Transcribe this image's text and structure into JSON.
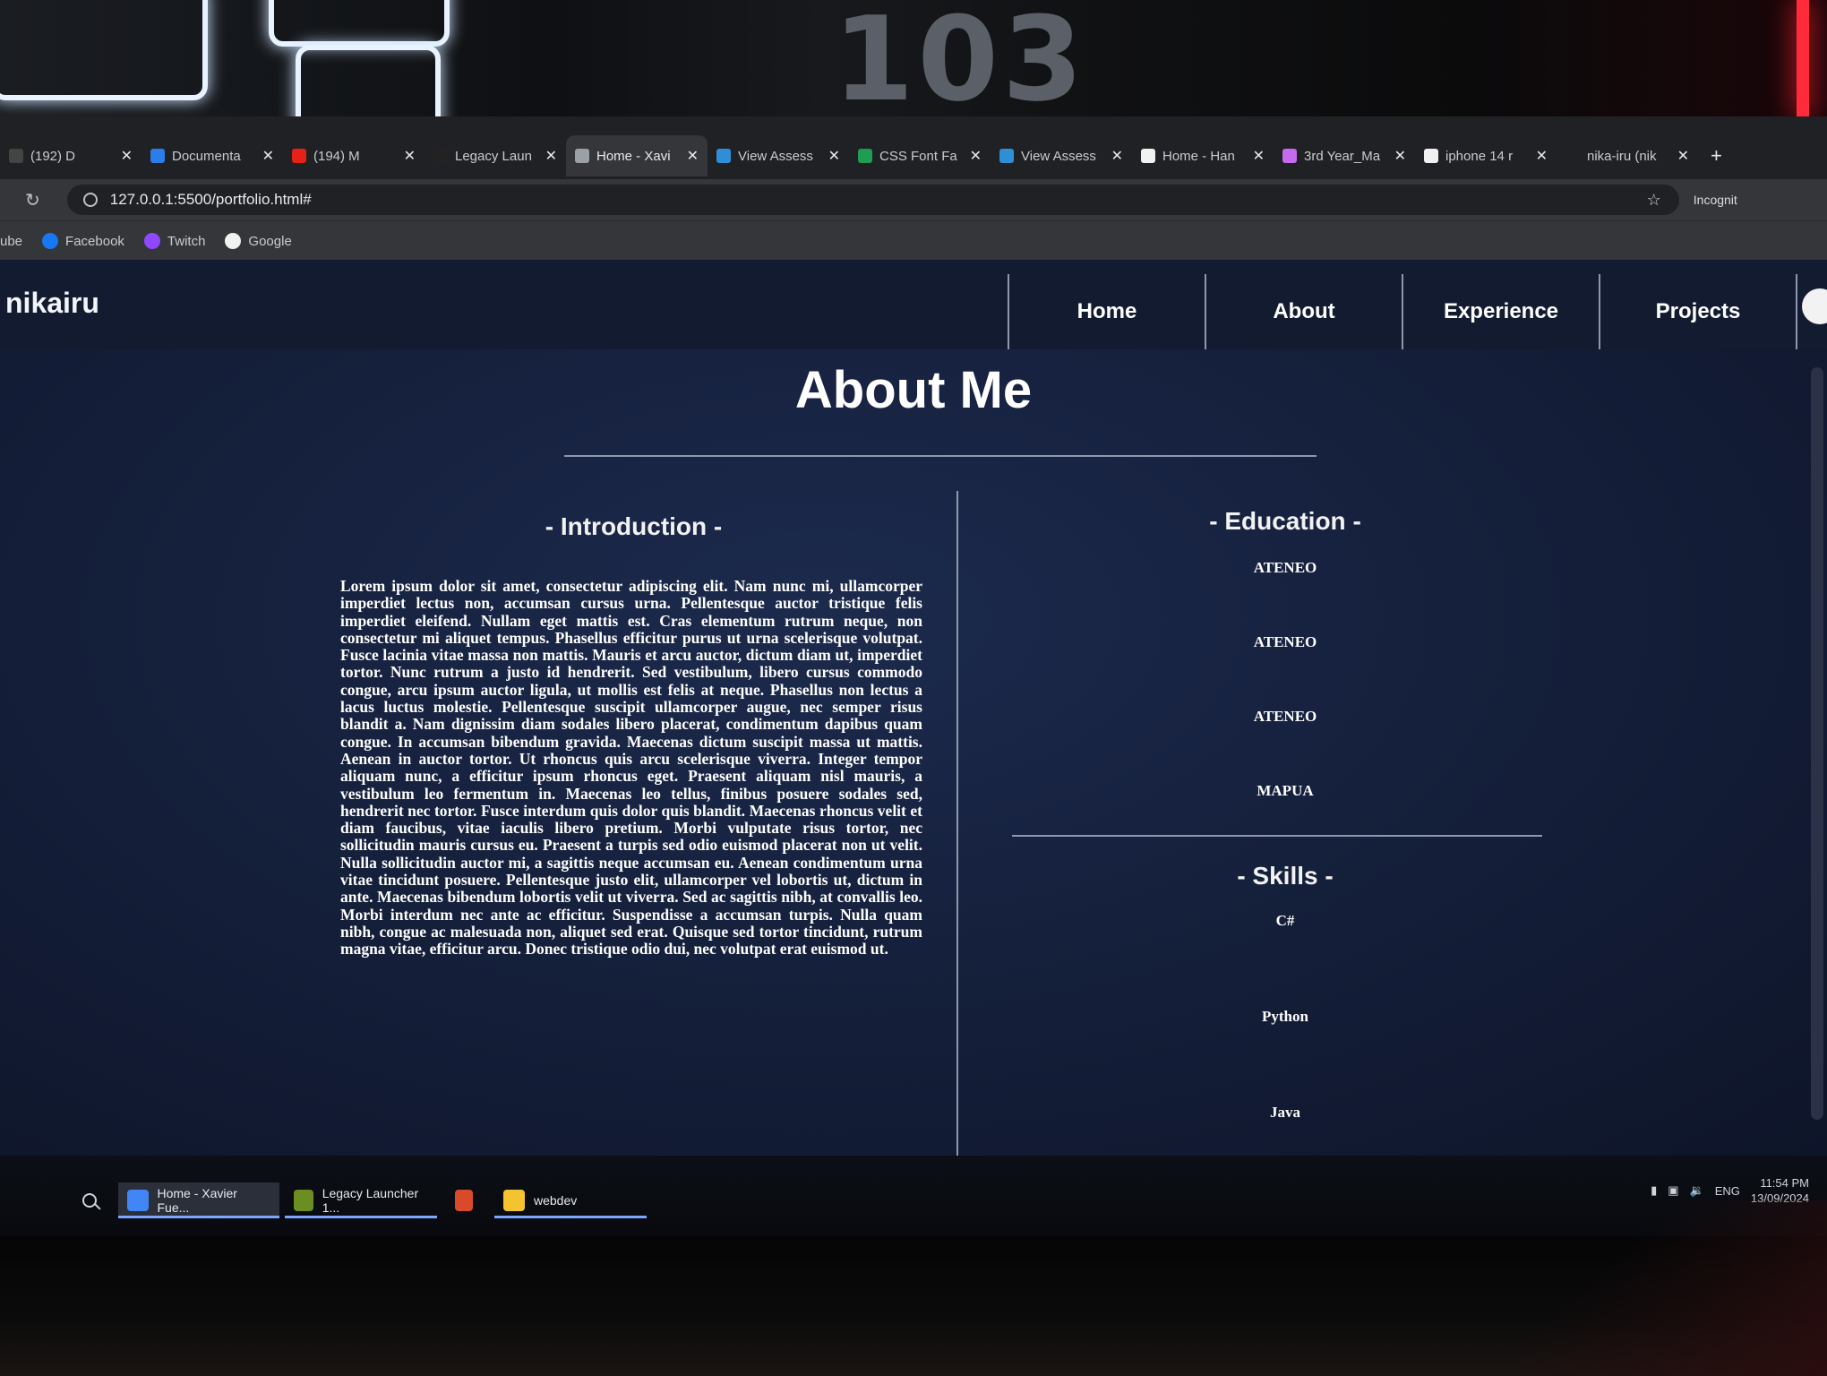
{
  "browser": {
    "tabs": [
      {
        "label": "(192) D",
        "fav": "#444",
        "active": false
      },
      {
        "label": "Documenta",
        "fav": "#2b7de9",
        "active": false
      },
      {
        "label": "(194) M",
        "fav": "#e62117",
        "active": false
      },
      {
        "label": "Legacy Laun",
        "fav": "#222",
        "active": false
      },
      {
        "label": "Home - Xavi",
        "fav": "#9aa0a6",
        "active": true
      },
      {
        "label": "View Assess",
        "fav": "#2f8fd6",
        "active": false
      },
      {
        "label": "CSS Font Fa",
        "fav": "#1f9d55",
        "active": false
      },
      {
        "label": "View Assess",
        "fav": "#2f8fd6",
        "active": false
      },
      {
        "label": "Home - Han",
        "fav": "#f1f1f1",
        "active": false
      },
      {
        "label": "3rd Year_Ma",
        "fav": "#c56bf0",
        "active": false
      },
      {
        "label": "iphone 14 r",
        "fav": "#f1f1f1",
        "active": false
      },
      {
        "label": "nika-iru (nik",
        "fav": "#202124",
        "active": false
      }
    ],
    "url": "127.0.0.1:5500/portfolio.html#",
    "incognito_label": "Incognit",
    "bookmarks": [
      {
        "label": "ube",
        "color": "#202124"
      },
      {
        "label": "Facebook",
        "color": "#1877f2"
      },
      {
        "label": "Twitch",
        "color": "#9146ff"
      },
      {
        "label": "Google",
        "color": "#f1f1f1"
      }
    ]
  },
  "site": {
    "brand": "nikairu",
    "nav": [
      "Home",
      "About",
      "Experience",
      "Projects"
    ],
    "title": "About Me",
    "intro_heading": "- Introduction -",
    "intro_text": "Lorem ipsum dolor sit amet, consectetur adipiscing elit. Nam nunc mi, ullamcorper imperdiet lectus non, accumsan cursus urna. Pellentesque auctor tristique felis imperdiet eleifend. Nullam eget mattis est. Cras elementum rutrum neque, non consectetur mi aliquet tempus. Phasellus efficitur purus ut urna scelerisque volutpat. Fusce lacinia vitae massa non mattis. Mauris et arcu auctor, dictum diam ut, imperdiet tortor. Nunc rutrum a justo id hendrerit. Sed vestibulum, libero cursus commodo congue, arcu ipsum auctor ligula, ut mollis est felis at neque. Phasellus non lectus a lacus luctus molestie. Pellentesque suscipit ullamcorper augue, nec semper risus blandit a. Nam dignissim diam sodales libero placerat, condimentum dapibus quam congue. In accumsan bibendum gravida. Maecenas dictum suscipit massa ut mattis. Aenean in auctor tortor. Ut rhoncus quis arcu scelerisque viverra. Integer tempor aliquam nunc, a efficitur ipsum rhoncus eget. Praesent aliquam nisl mauris, a vestibulum leo fermentum in. Maecenas leo tellus, finibus posuere sodales sed, hendrerit nec tortor. Fusce interdum quis dolor quis blandit. Maecenas rhoncus velit et diam faucibus, vitae iaculis libero pretium. Morbi vulputate risus tortor, nec sollicitudin mauris cursus eu. Praesent a turpis sed odio euismod placerat non ut velit. Nulla sollicitudin auctor mi, a sagittis neque accumsan eu. Aenean condimentum urna vitae tincidunt posuere. Pellentesque justo elit, ullamcorper vel lobortis ut, dictum in ante. Maecenas bibendum lobortis velit ut viverra. Sed ac sagittis nibh, at convallis leo. Morbi interdum nec ante ac efficitur. Suspendisse a accumsan turpis. Nulla quam nibh, congue ac malesuada non, aliquet sed erat. Quisque sed tortor tincidunt, rutrum magna vitae, efficitur arcu. Donec tristique odio dui, nec volutpat erat euismod ut.",
    "education_heading": "- Education -",
    "education": [
      "ATENEO",
      "ATENEO",
      "ATENEO",
      "MAPUA"
    ],
    "skills_heading": "- Skills -",
    "skills": [
      "C#",
      "Python",
      "Java"
    ]
  },
  "taskbar": {
    "apps": [
      {
        "label": "Home - Xavier Fue...",
        "color": "#4285f4"
      },
      {
        "label": "Legacy Launcher 1...",
        "color": "#6b8e23"
      },
      {
        "label": "",
        "color": "#d94a2b"
      },
      {
        "label": "webdev",
        "color": "#f4c430"
      }
    ],
    "lang": "ENG",
    "time": "11:54 PM",
    "date": "13/09/2024"
  },
  "room": {
    "poster_number": "103"
  }
}
